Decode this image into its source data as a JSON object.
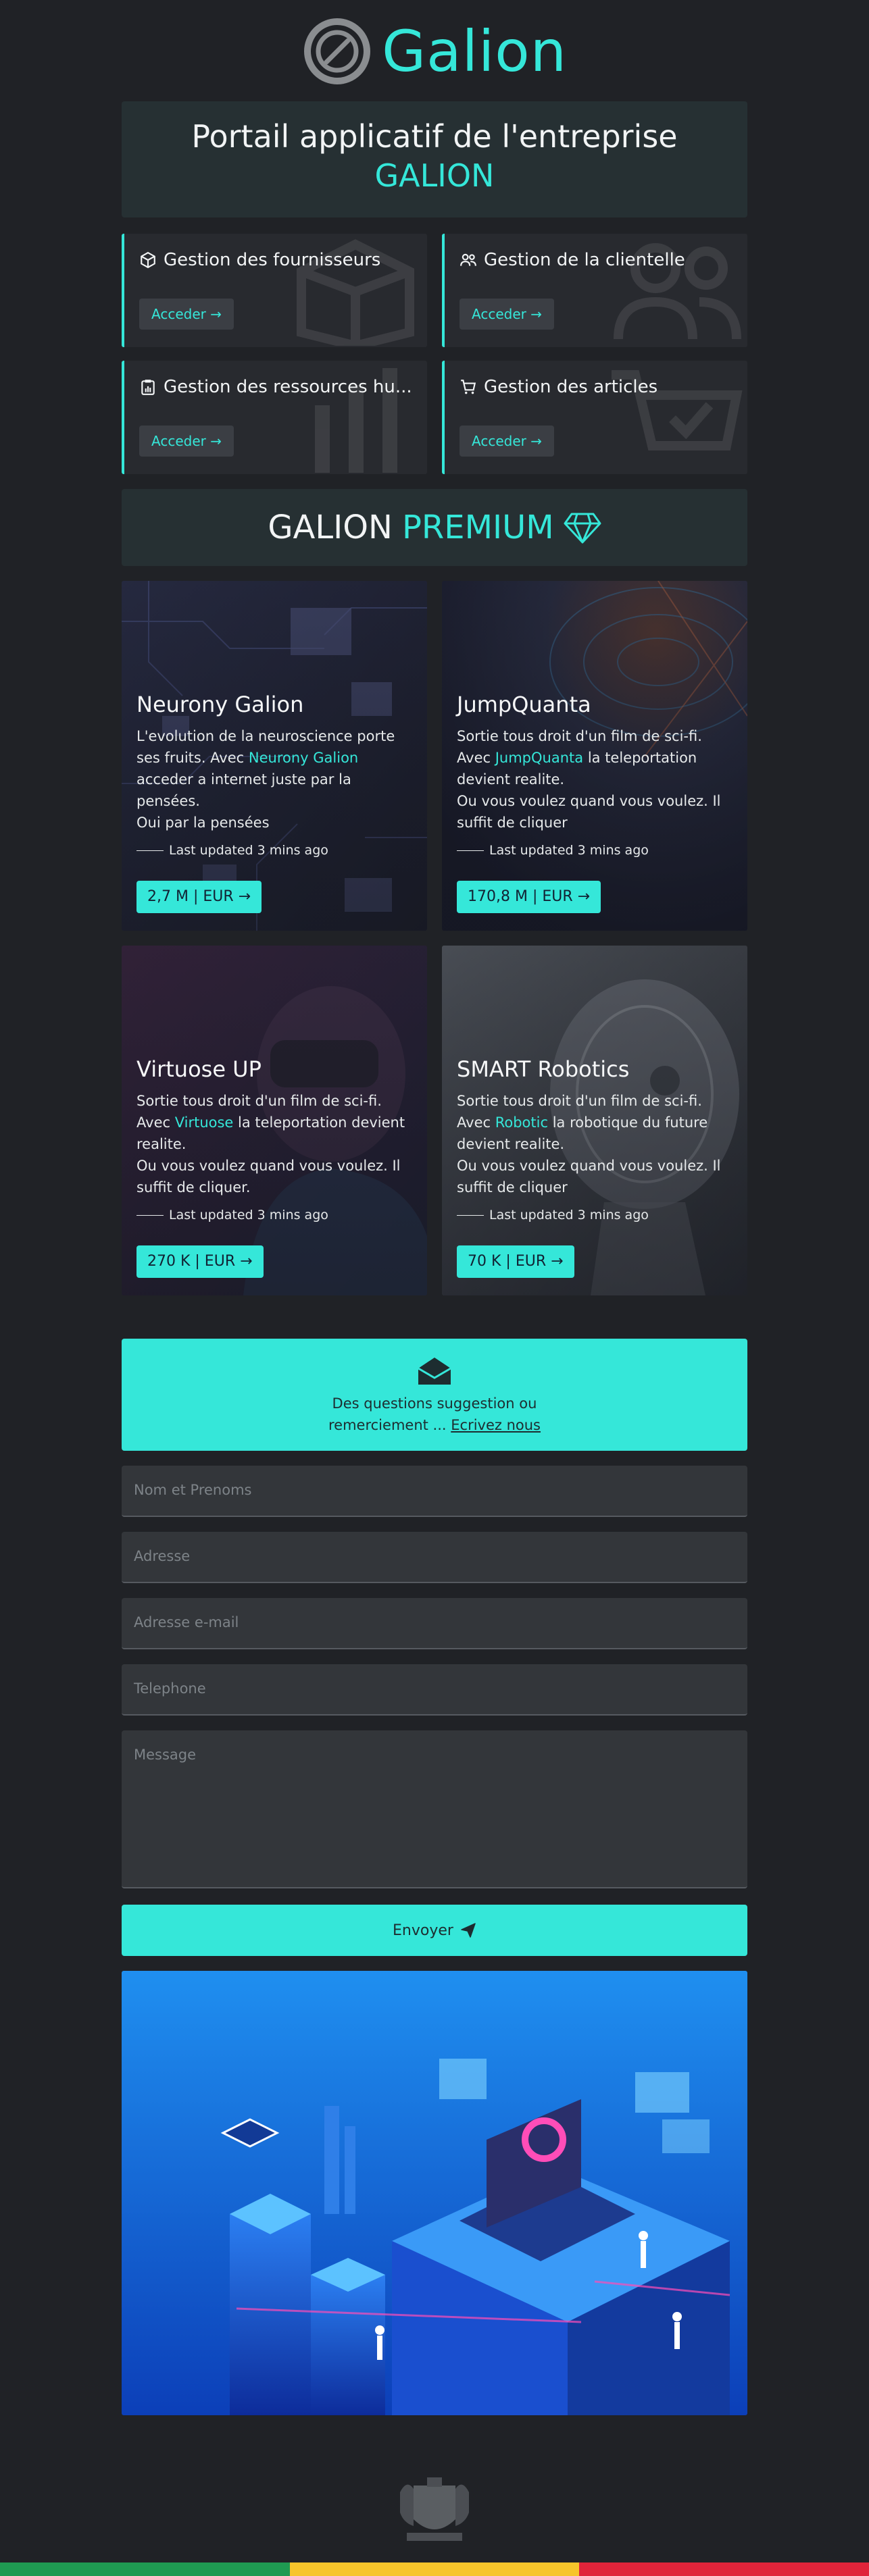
{
  "brand": {
    "name": "Galion",
    "accent": "#35e7d9"
  },
  "portal": {
    "title_line1": "Portail applicatif de l'entreprise",
    "title_line2": "GALION"
  },
  "management": [
    {
      "label": "Gestion des fournisseurs",
      "button": "Acceder",
      "icon": "box-icon"
    },
    {
      "label": "Gestion de la clientelle",
      "button": "Acceder",
      "icon": "users-icon"
    },
    {
      "label": "Gestion des ressources hu...",
      "button": "Acceder",
      "icon": "clipboard-chart-icon"
    },
    {
      "label": "Gestion des articles",
      "button": "Acceder",
      "icon": "cart-icon"
    }
  ],
  "premium": {
    "word1": "GALION",
    "word2": "PREMIUM"
  },
  "products": [
    {
      "title": "Neurony Galion",
      "text_before": "L'evolution de la neuroscience porte ses fruits. Avec ",
      "highlight": "Neurony Galion",
      "text_after": " acceder a internet juste par la pensées.",
      "text_extra": "Oui par la pensées",
      "updated": "Last updated 3 mins ago",
      "price": "2,7 M | EUR"
    },
    {
      "title": "JumpQuanta",
      "text_before": "Sortie tous droit d'un film de sci-fi. Avec ",
      "highlight": "JumpQuanta",
      "text_after": " la teleportation devient realite.",
      "text_extra": "Ou vous voulez quand vous voulez. Il suffit de cliquer",
      "updated": "Last updated 3 mins ago",
      "price": "170,8 M | EUR"
    },
    {
      "title": "Virtuose UP",
      "text_before": "Sortie tous droit d'un film de sci-fi. Avec ",
      "highlight": "Virtuose",
      "text_after": " la teleportation devient realite.",
      "text_extra": "Ou vous voulez quand vous voulez. Il suffit de cliquer.",
      "updated": "Last updated 3 mins ago",
      "price": "270 K | EUR"
    },
    {
      "title": "SMART Robotics",
      "text_before": "Sortie tous droit d'un film de sci-fi. Avec ",
      "highlight": "Robotic",
      "text_after": " la robotique du future devient realite.",
      "text_extra": "Ou vous voulez quand vous voulez. Il suffit de cliquer",
      "updated": "Last updated 3 mins ago",
      "price": "70 K | EUR"
    }
  ],
  "contact": {
    "line1": "Des questions suggestion ou",
    "line2": "remerciement ... ",
    "link": "Ecrivez nous"
  },
  "form": {
    "name_placeholder": "Nom et Prenoms",
    "address_placeholder": "Adresse",
    "email_placeholder": "Adresse e-mail",
    "phone_placeholder": "Telephone",
    "message_placeholder": "Message",
    "send_label": "Envoyer"
  },
  "flag_colors": [
    "#1f9a52",
    "#f7c52b",
    "#e0243a"
  ]
}
